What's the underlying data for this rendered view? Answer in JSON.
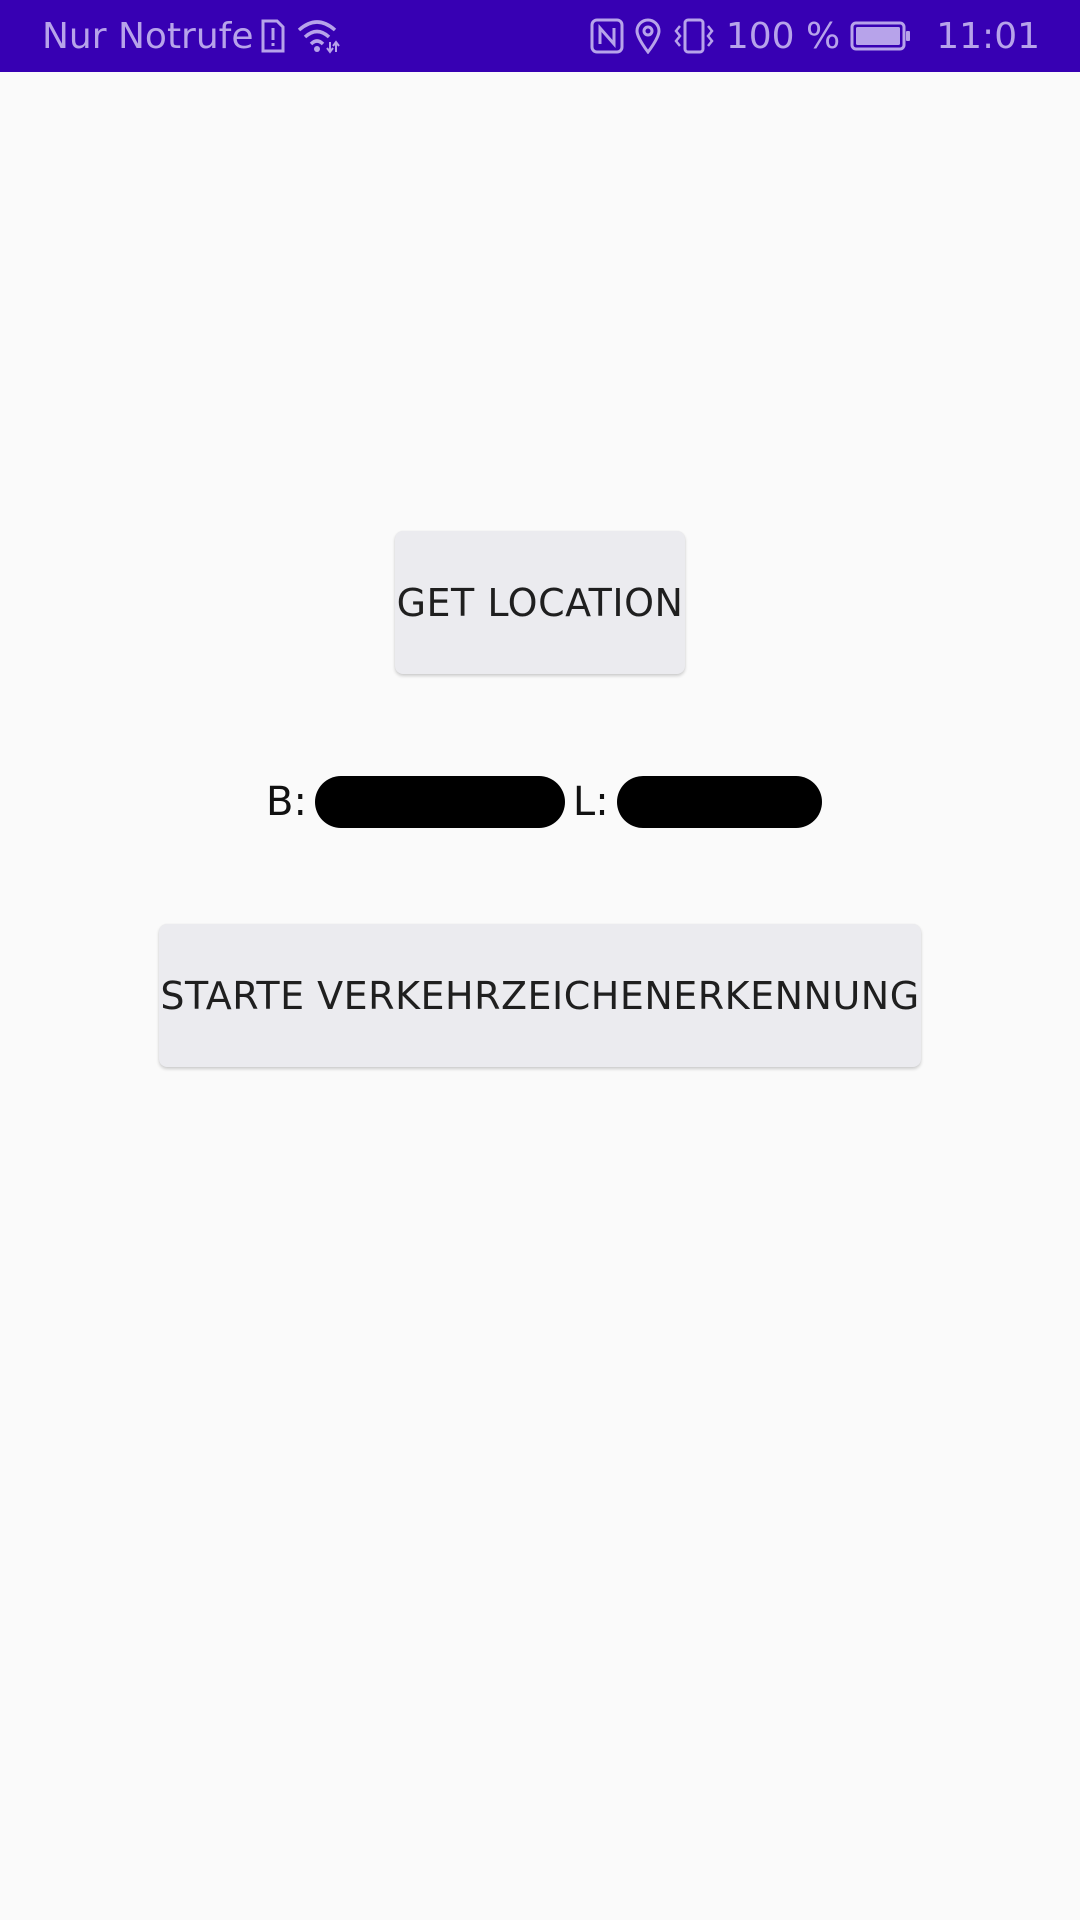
{
  "status_bar": {
    "carrier": "Nur Notrufe",
    "battery": "100 %",
    "time": "11:01",
    "left_icons": [
      "sim-alert-icon",
      "wifi-icon"
    ],
    "right_icons": [
      "nfc-icon",
      "location-icon",
      "vibrate-icon",
      "battery-icon"
    ],
    "bg_color": "#3700b3",
    "fg_color": "#b7a3ea"
  },
  "main": {
    "get_location_label": "GET LOCATION",
    "latitude_label": "B:",
    "longitude_label": "L:",
    "start_recognition_label": "STARTE VERKEHRZEICHENERKENNUNG"
  }
}
